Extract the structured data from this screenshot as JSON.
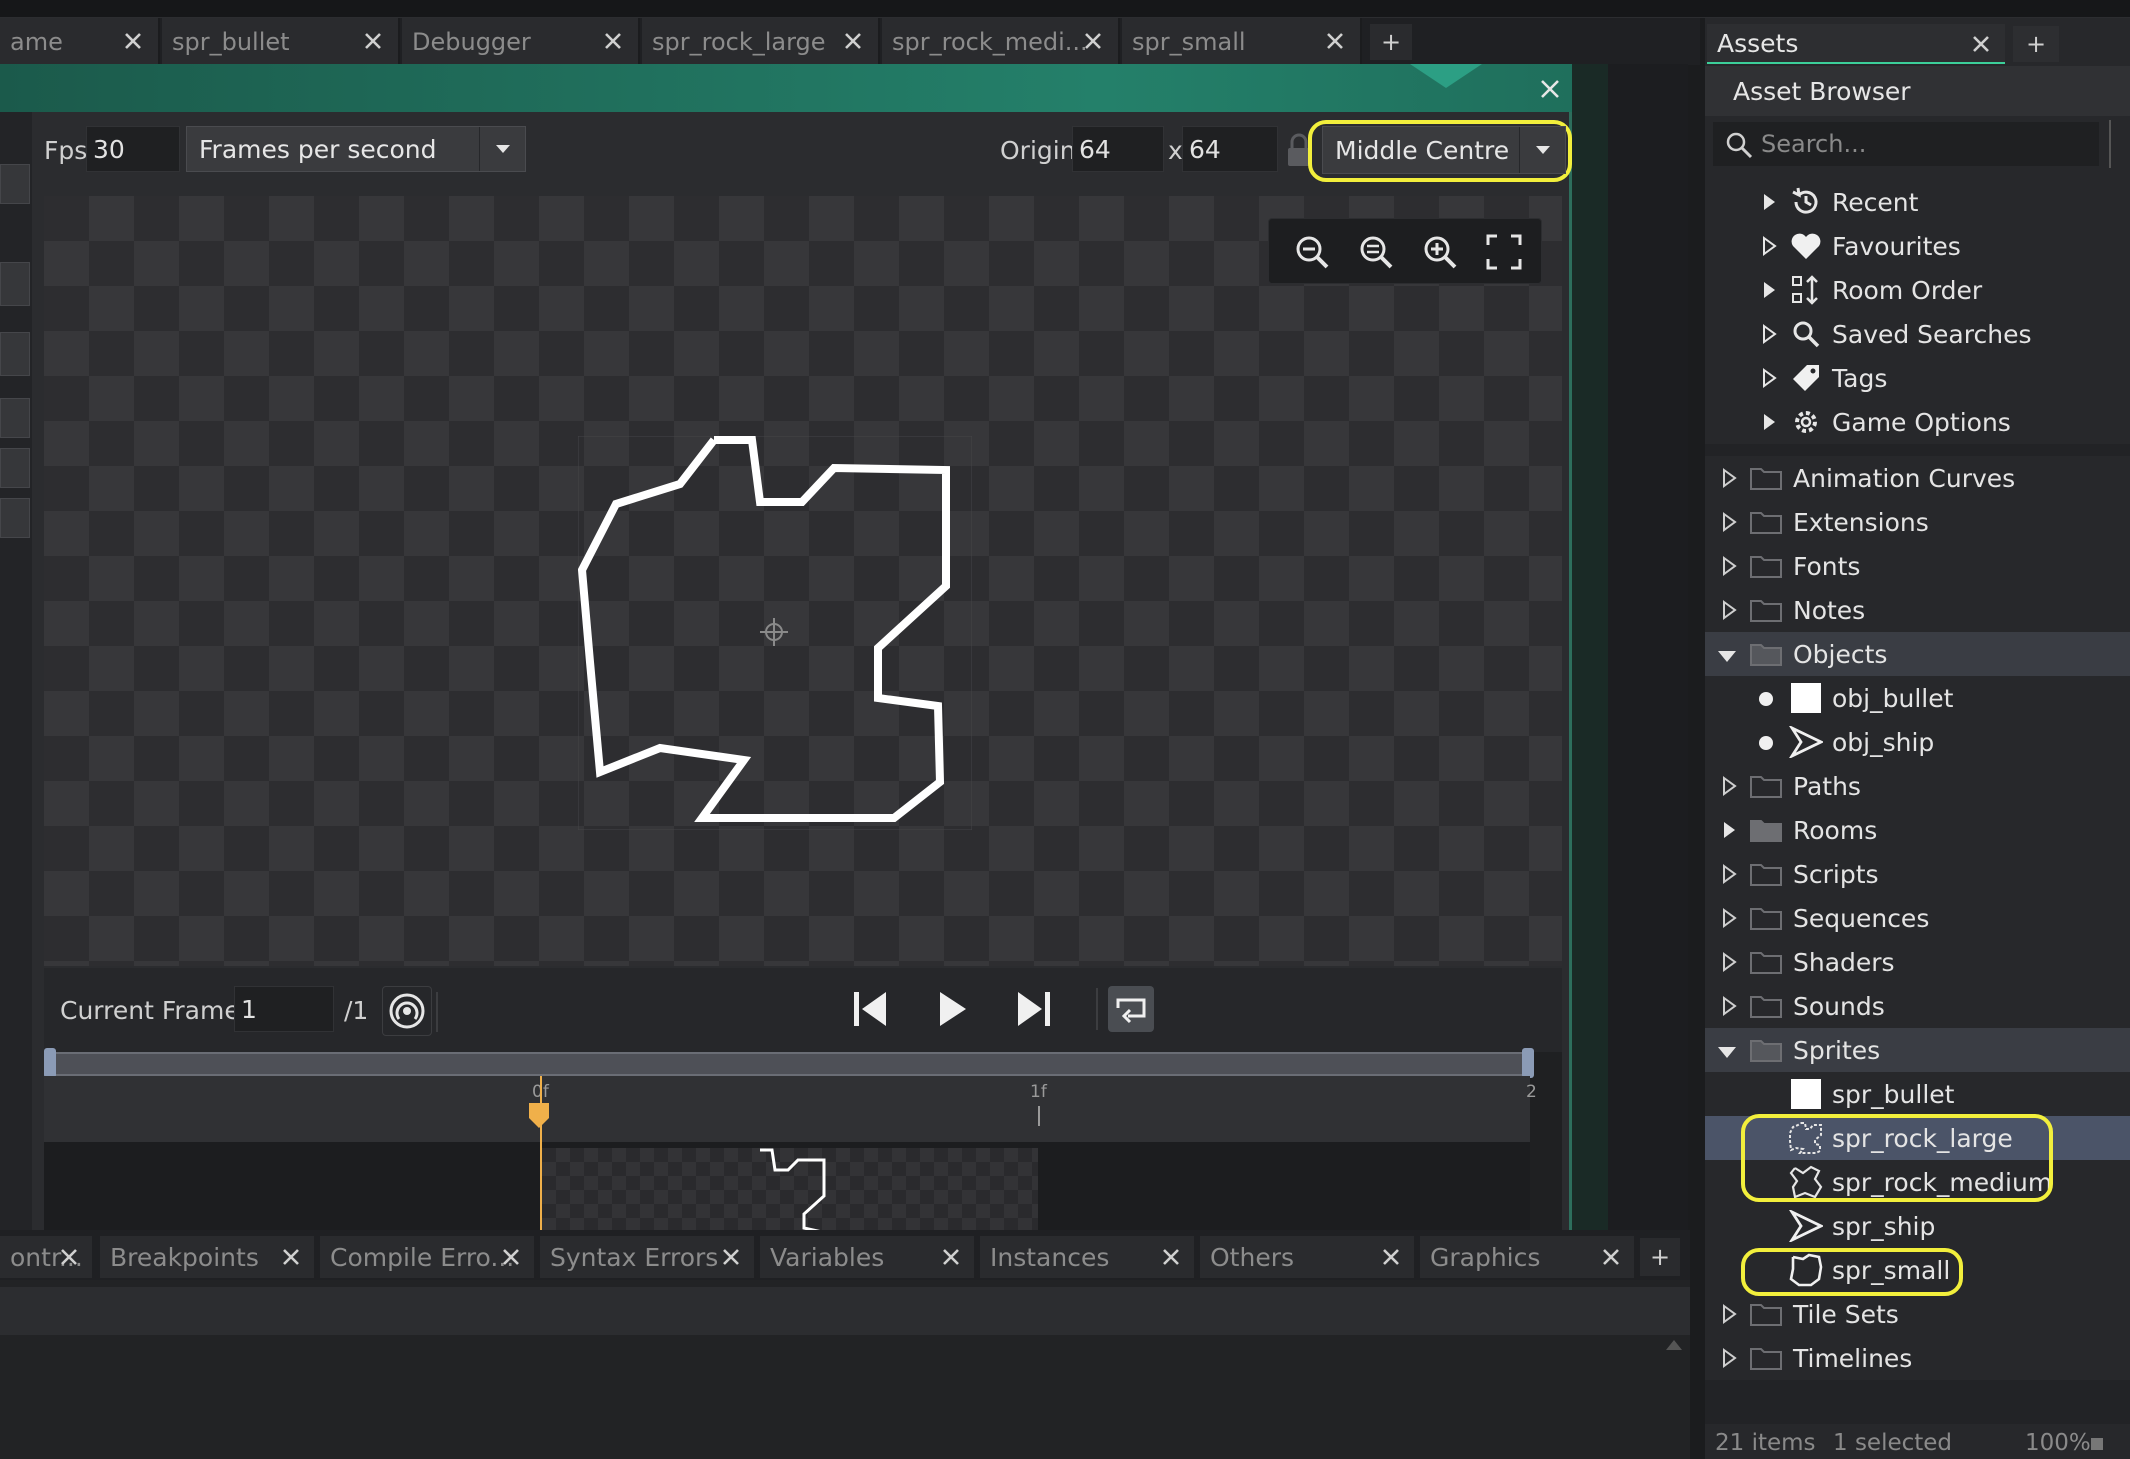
{
  "editor_tabs": [
    {
      "label": "ame"
    },
    {
      "label": "spr_bullet"
    },
    {
      "label": "Debugger"
    },
    {
      "label": "spr_rock_large"
    },
    {
      "label": "spr_rock_medi..."
    },
    {
      "label": "spr_small"
    }
  ],
  "editor_tab_add": "+",
  "sprite_editor": {
    "fps_label": "Fps",
    "fps_value": "30",
    "fps_mode": "Frames per second",
    "origin_label": "Origin",
    "origin_x": "64",
    "origin_sep": "x",
    "origin_y": "64",
    "origin_preset": "Middle Centre",
    "current_frame_label": "Current Frame:",
    "current_frame_value": "1",
    "frame_total": "/1",
    "ruler_labels": [
      "0f",
      "1f",
      "2"
    ]
  },
  "bottom_tabs": [
    {
      "label": "ontr..."
    },
    {
      "label": "Breakpoints"
    },
    {
      "label": "Compile Erro..."
    },
    {
      "label": "Syntax Errors"
    },
    {
      "label": "Variables"
    },
    {
      "label": "Instances"
    },
    {
      "label": "Others"
    },
    {
      "label": "Graphics"
    }
  ],
  "bottom_tab_add": "+",
  "assets": {
    "tab_label": "Assets",
    "tab_add": "+",
    "title": "Asset Browser",
    "search_placeholder": "Search...",
    "items": [
      {
        "label": "Recent",
        "icon": "history-icon"
      },
      {
        "label": "Favourites",
        "icon": "heart-icon"
      },
      {
        "label": "Room Order",
        "icon": "room-order-icon"
      },
      {
        "label": "Saved Searches",
        "icon": "search-icon"
      },
      {
        "label": "Tags",
        "icon": "tag-icon"
      },
      {
        "label": "Game Options",
        "icon": "gear-icon"
      },
      {
        "label": "Animation Curves",
        "icon": "folder-icon"
      },
      {
        "label": "Extensions",
        "icon": "folder-icon"
      },
      {
        "label": "Fonts",
        "icon": "folder-icon"
      },
      {
        "label": "Notes",
        "icon": "folder-icon"
      },
      {
        "label": "Objects",
        "icon": "folder-icon"
      },
      {
        "label": "obj_bullet",
        "icon": "white-square-icon"
      },
      {
        "label": "obj_ship",
        "icon": "ship-icon"
      },
      {
        "label": "Paths",
        "icon": "folder-icon"
      },
      {
        "label": "Rooms",
        "icon": "folder-icon"
      },
      {
        "label": "Scripts",
        "icon": "folder-icon"
      },
      {
        "label": "Sequences",
        "icon": "folder-icon"
      },
      {
        "label": "Shaders",
        "icon": "folder-icon"
      },
      {
        "label": "Sounds",
        "icon": "folder-icon"
      },
      {
        "label": "Sprites",
        "icon": "folder-icon"
      },
      {
        "label": "spr_bullet",
        "icon": "white-square-icon"
      },
      {
        "label": "spr_rock_large",
        "icon": "rock-icon"
      },
      {
        "label": "spr_rock_medium",
        "icon": "rock-icon"
      },
      {
        "label": "spr_ship",
        "icon": "ship-icon"
      },
      {
        "label": "spr_small",
        "icon": "rock-icon"
      },
      {
        "label": "Tile Sets",
        "icon": "folder-icon"
      },
      {
        "label": "Timelines",
        "icon": "folder-icon"
      }
    ],
    "footer_items": "21 items",
    "footer_selected": "1 selected",
    "footer_zoom": "100%"
  },
  "colors": {
    "accent_green": "#24806a",
    "highlight_yellow": "#f2ef3c",
    "playhead_orange": "#f0b04a"
  }
}
